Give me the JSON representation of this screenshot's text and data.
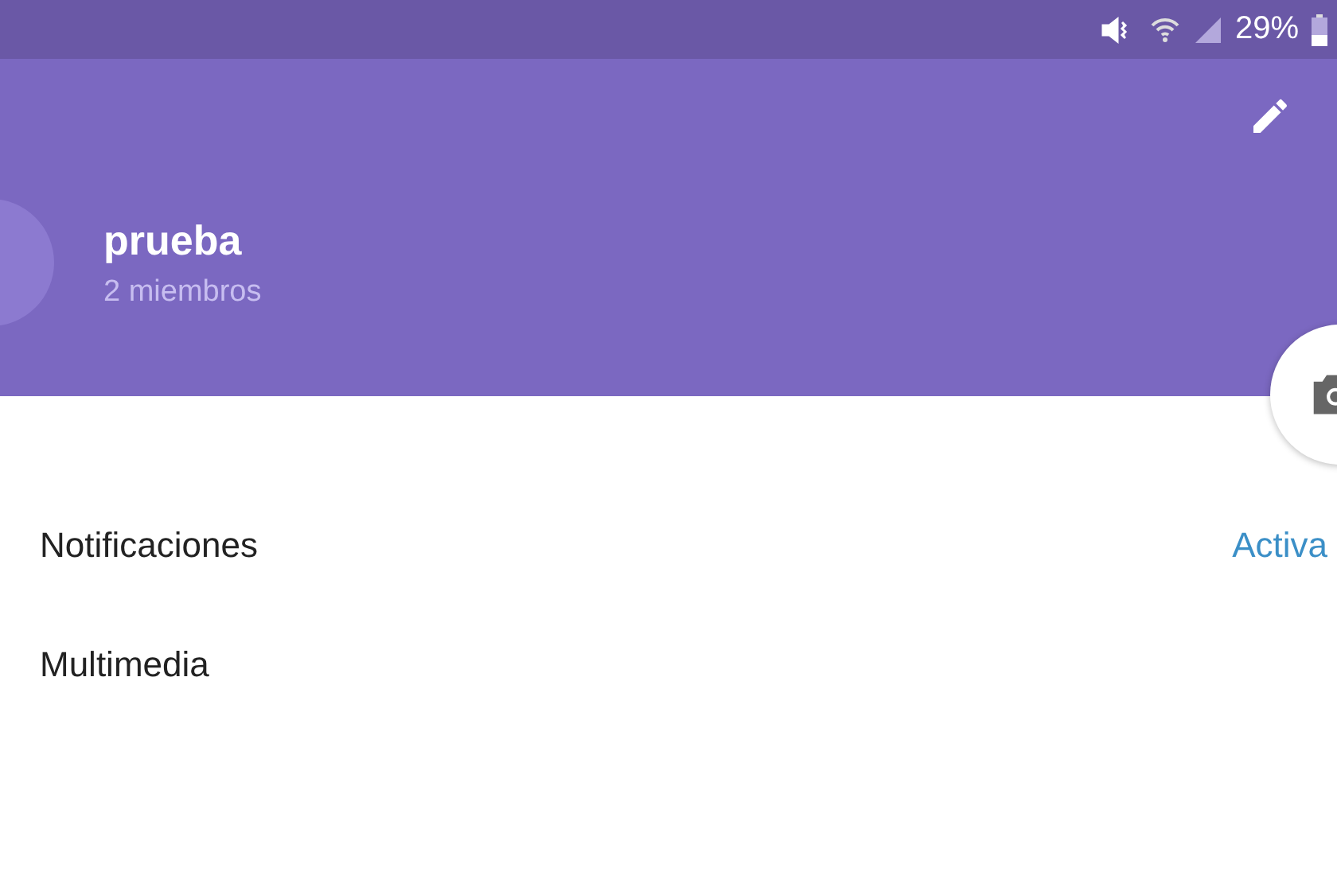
{
  "status_bar": {
    "battery_text": "29%"
  },
  "header": {
    "title": "prueba",
    "subtitle": "2 miembros"
  },
  "rows": [
    {
      "label": "Notificaciones",
      "value": "Activa"
    },
    {
      "label": "Multimedia"
    }
  ]
}
